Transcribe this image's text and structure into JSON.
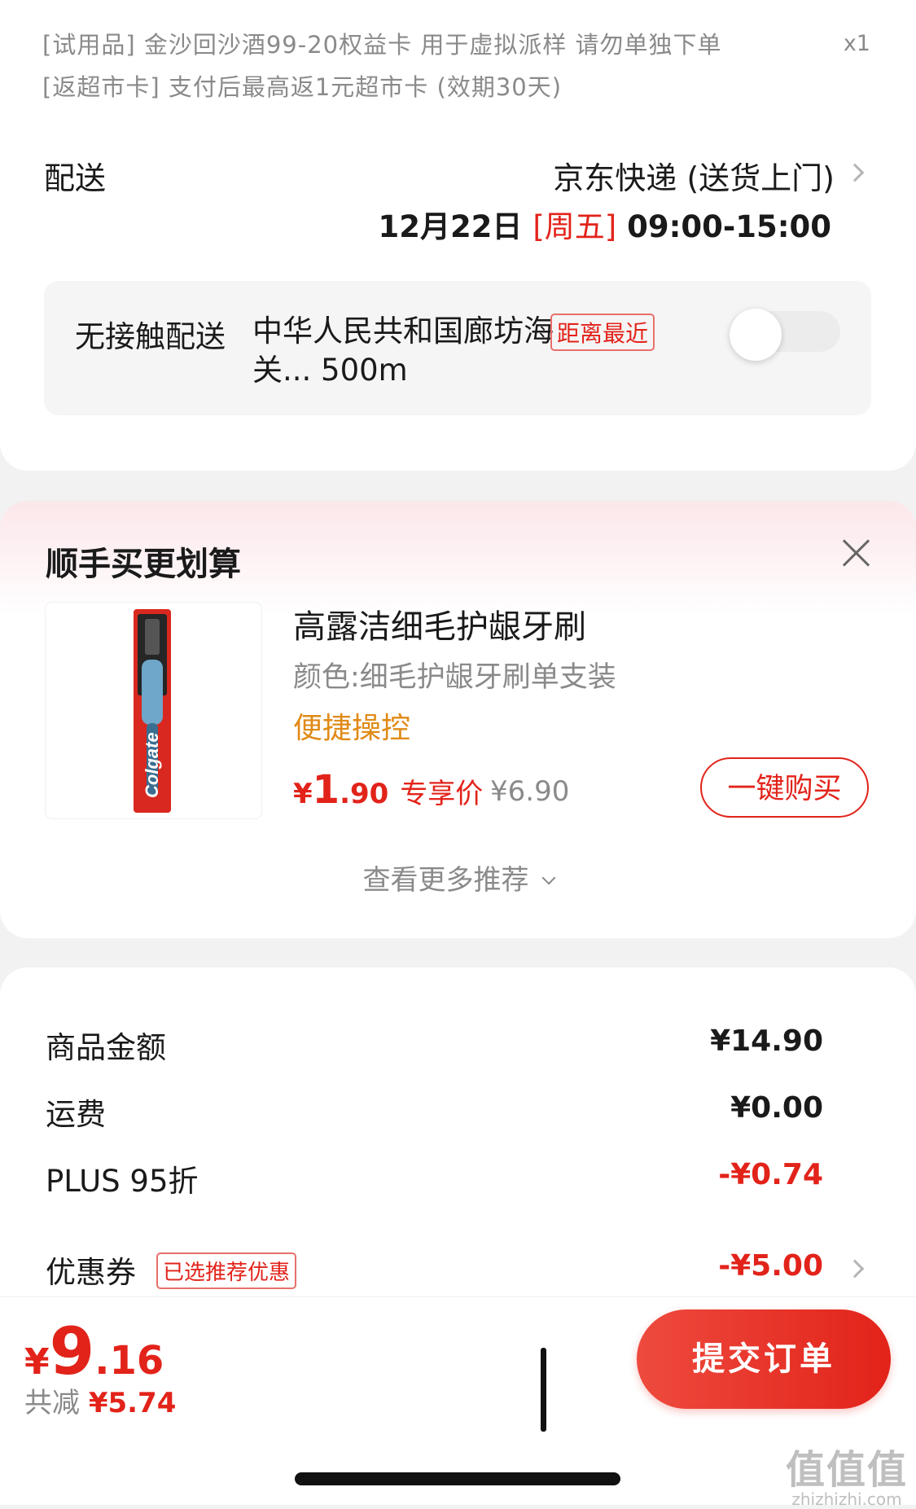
{
  "gift": {
    "line1": "[试用品] 金沙回沙酒99-20权益卡 用于虚拟派样  请勿单独下单",
    "line2": "[返超市卡] 支付后最高返1元超市卡 (效期30天)",
    "qty": "x1"
  },
  "shipping": {
    "label": "配送",
    "method": "京东快递 (送货上门)",
    "date": "12月22日 ",
    "weekday": "[周五]",
    "time": " 09:00-15:00"
  },
  "contactless": {
    "label": "无接触配送",
    "address": "中华人民共和国廊坊海关... 500m",
    "tag": "距离最近",
    "enabled": false
  },
  "recommend": {
    "title": "顺手买更划算",
    "product": {
      "image_icon": "toothbrush-image",
      "brand_text": "Colgate",
      "name": "高露洁细毛护龈牙刷",
      "spec": "颜色:细毛护龈牙刷单支装",
      "feature": "便捷操控",
      "price_currency": "¥",
      "price_int": "1",
      "price_dec": ".90",
      "price_tag": "专享价",
      "original_price": "¥6.90",
      "buy_label": "一键购买"
    },
    "more_label": "查看更多推荐"
  },
  "amounts": {
    "rows": [
      {
        "label": "商品金额",
        "value": "¥14.90"
      },
      {
        "label": "运费",
        "value": "¥0.00"
      },
      {
        "label": "PLUS 95折",
        "value": "-¥0.74"
      },
      {
        "label": "优惠券",
        "value": "-¥5.00"
      }
    ],
    "coupon_tag": "已选推荐优惠"
  },
  "footer": {
    "total_currency": "¥",
    "total_int": "9",
    "total_dec": ".16",
    "saved_label": "共减 ",
    "saved_value": "¥5.74",
    "submit_label": "提交订单"
  },
  "watermark": {
    "big": "值值值",
    "small": "zhizhizhi.com"
  },
  "colors": {
    "accent": "#e2231a",
    "feature": "#e08a16",
    "muted": "#8a8a8a"
  }
}
